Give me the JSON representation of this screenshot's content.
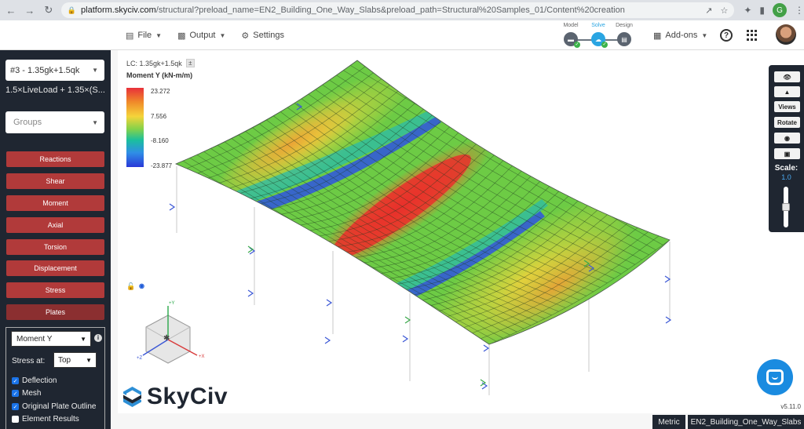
{
  "browser": {
    "url_host": "platform.skyciv.com",
    "url_path": "/structural?preload_name=EN2_Building_One_Way_Slabs&preload_path=Structural%20Samples_01/Content%20creation",
    "profile_initial": "G"
  },
  "toolbar": {
    "file_label": "File",
    "output_label": "Output",
    "settings_label": "Settings",
    "addons_label": "Add-ons",
    "workflow": [
      {
        "label": "Model",
        "active": false
      },
      {
        "label": "Solve",
        "active": true
      },
      {
        "label": "Design",
        "active": false
      }
    ]
  },
  "sidebar": {
    "load_combo": "#3 - 1.35gk+1.5qk",
    "load_combo_desc": "1.5×LiveLoad + 1.35×(S...",
    "groups_placeholder": "Groups",
    "results": [
      {
        "label": "Reactions",
        "active": false
      },
      {
        "label": "Shear",
        "active": false
      },
      {
        "label": "Moment",
        "active": false
      },
      {
        "label": "Axial",
        "active": false
      },
      {
        "label": "Torsion",
        "active": false
      },
      {
        "label": "Displacement",
        "active": false
      },
      {
        "label": "Stress",
        "active": false
      },
      {
        "label": "Plates",
        "active": true
      }
    ],
    "plates": {
      "result_type": "Moment Y",
      "stress_at_label": "Stress at:",
      "stress_at_value": "Top",
      "options": [
        {
          "label": "Deflection",
          "checked": true
        },
        {
          "label": "Mesh",
          "checked": true
        },
        {
          "label": "Original Plate Outline",
          "checked": true
        },
        {
          "label": "Element Results",
          "checked": false
        }
      ]
    }
  },
  "viewport": {
    "lc_label": "LC: 1.35gk+1.5qk",
    "legend": {
      "title": "Moment Y (kN-m/m)",
      "values": [
        "23.272",
        "7.556",
        "-8.160",
        "-23.877"
      ],
      "colors": [
        "#e8303a",
        "#f5d43a",
        "#84d24a",
        "#2f8ee6",
        "#2a39d8"
      ]
    },
    "axis_labels": {
      "y": "+Y",
      "x": "+X",
      "z": "+Z"
    },
    "logo_text": "SkyCiv",
    "version": "v5.11.0"
  },
  "right_panel": {
    "views_label": "Views",
    "rotate_label": "Rotate",
    "scale_label": "Scale:",
    "scale_value": "1.0",
    "scale_level": 0.5
  },
  "footer": {
    "units_label": "Metric",
    "project_name": "EN2_Building_One_Way_Slabs"
  }
}
